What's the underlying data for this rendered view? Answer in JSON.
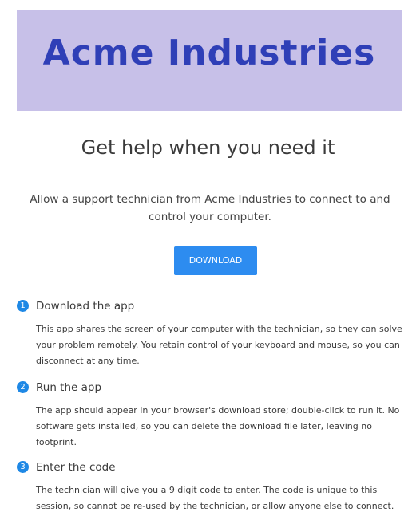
{
  "banner": {
    "title": "Acme Industries"
  },
  "headline": "Get help when you need it",
  "intro": "Allow a support technician from Acme Industries to connect to and control your computer.",
  "download_button": "DOWNLOAD",
  "steps": [
    {
      "number": "1",
      "title": "Download the app",
      "body": "This app shares the screen of your computer with the technician, so they can solve your problem remotely. You retain control of your keyboard and mouse, so you can disconnect at any time."
    },
    {
      "number": "2",
      "title": "Run the app",
      "body": "The app should appear in your browser's download store; double-click to run it. No software gets installed, so you can delete the download file later, leaving no footprint."
    },
    {
      "number": "3",
      "title": "Enter the code",
      "body": "The technician will give you a 9 digit code to enter. The code is unique to this session, so cannot be re-used by the technician, or allow anyone else to connect."
    }
  ],
  "colors": {
    "banner_bg": "#c7c0e8",
    "banner_text": "#2f3fb7",
    "accent": "#2d8cf0"
  }
}
